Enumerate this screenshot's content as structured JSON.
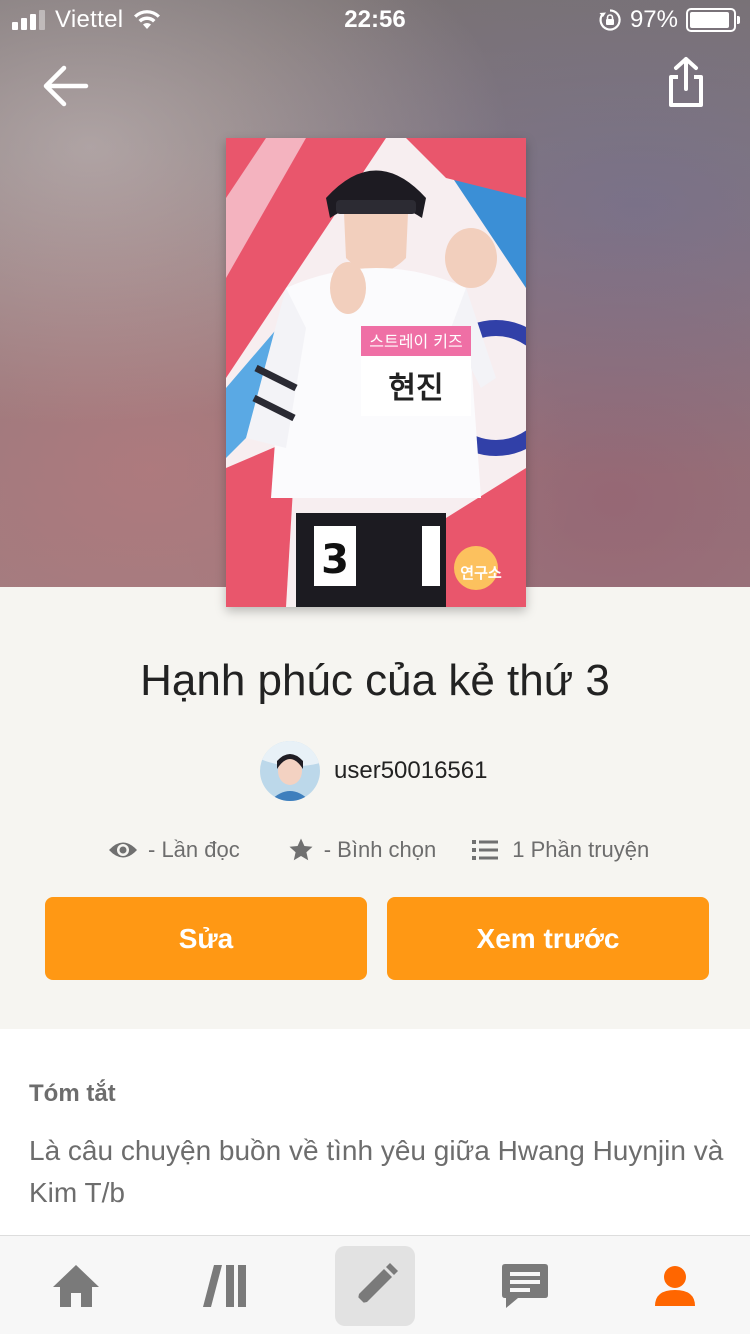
{
  "status_bar": {
    "carrier": "Viettel",
    "time": "22:56",
    "battery_percent": "97%",
    "battery_level": 0.97,
    "signal_bars": 3
  },
  "story": {
    "title": "Hạnh phúc của kẻ thứ 3",
    "author": "user50016561",
    "stats": {
      "reads": "- Lần đọc",
      "votes": "- Bình chọn",
      "parts": "1 Phần truyện"
    }
  },
  "actions": {
    "edit_label": "Sửa",
    "preview_label": "Xem trước"
  },
  "summary": {
    "label": "Tóm tắt",
    "text": "Là câu chuyện buồn về tình yêu giữa Hwang Huynjin và Kim T/b"
  },
  "bottom_nav": {
    "active": "write",
    "items": [
      "home",
      "library",
      "write",
      "messages",
      "profile"
    ]
  },
  "colors": {
    "accent": "#ff9814",
    "profile_active": "#ff6600",
    "nav_icon": "#7a7a7a"
  },
  "cover_text": {
    "name_tag_top": "스트레이 키즈",
    "name_tag": "현진",
    "number": "3",
    "logo": "연구소"
  }
}
